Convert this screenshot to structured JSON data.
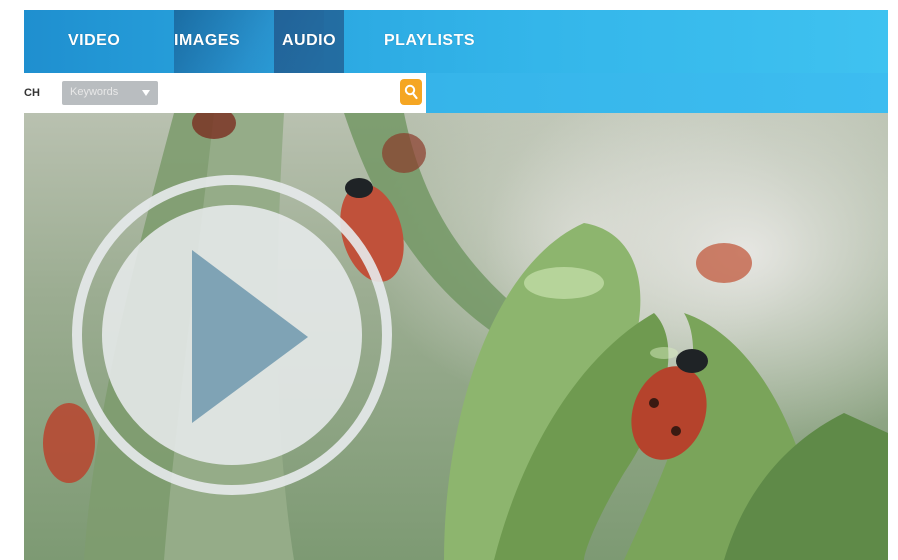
{
  "nav": {
    "items": [
      {
        "label": "VIDEO"
      },
      {
        "label": "IMAGES"
      },
      {
        "label": "AUDIO"
      },
      {
        "label": "PLAYLISTS"
      }
    ],
    "active_index": 2
  },
  "search": {
    "label": "CH",
    "select_value": "Keywords",
    "placeholder": "",
    "button_icon": "search-icon"
  },
  "video": {
    "icon": "play-icon",
    "subject": "ladybugs on leaves"
  },
  "colors": {
    "nav_blue": "#2aa6e0",
    "search_button": "#f5a623",
    "play_triangle": "#7fa3b5"
  }
}
